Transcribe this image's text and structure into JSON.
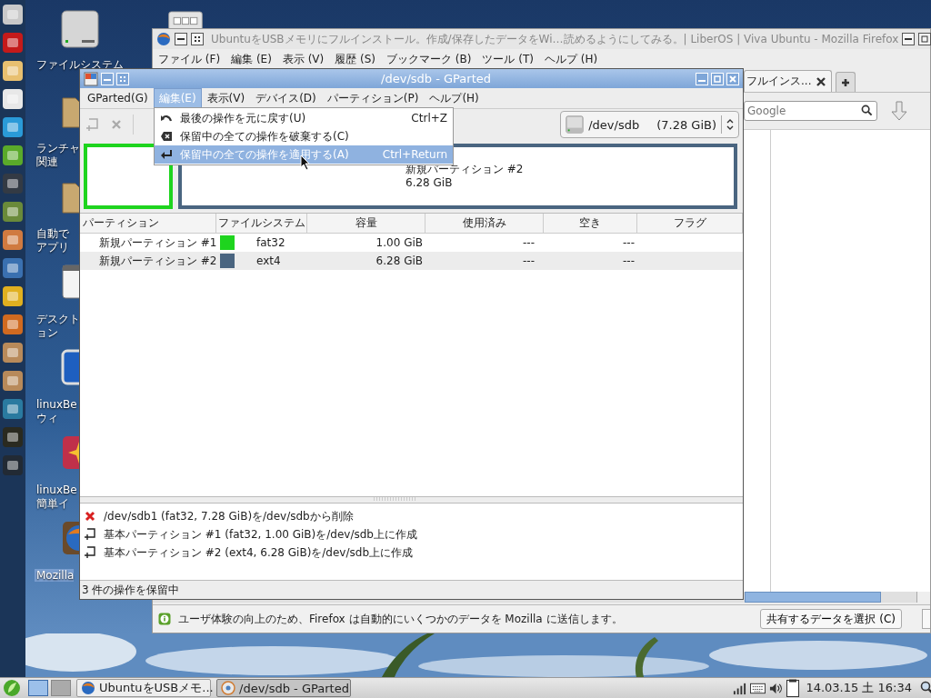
{
  "desktop_icons": [
    {
      "kind": "drive",
      "lines": [
        "ファイルシステム"
      ],
      "selected": false
    },
    {
      "kind": "folder",
      "lines": [
        "ランチャ",
        "関連"
      ],
      "selected": false
    },
    {
      "kind": "folder",
      "lines": [
        "自動で",
        "アプリ"
      ],
      "selected": false
    },
    {
      "kind": "window",
      "lines": [
        "デスクト",
        "ョン"
      ],
      "selected": false
    },
    {
      "kind": "blue-app",
      "lines": [
        "linuxBe",
        "ウィ"
      ],
      "selected": false
    },
    {
      "kind": "red-app",
      "lines": [
        "linuxBe",
        "簡単イ"
      ],
      "selected": false
    },
    {
      "kind": "globe",
      "lines": [
        "Mozilla"
      ],
      "selected": true
    }
  ],
  "firefox": {
    "title": "UbuntuをUSBメモリにフルインストール。作成/保存したデータをWi…読めるようにしてみる。| LiberOS | Viva Ubuntu - Mozilla Firefox",
    "menu": [
      "ファイル (F)",
      "編集 (E)",
      "表示 (V)",
      "履歴 (S)",
      "ブックマーク (B)",
      "ツール (T)",
      "ヘルプ (H)"
    ],
    "tab": {
      "label": "フルインス..."
    },
    "search": {
      "placeholder": "Google"
    },
    "notification": {
      "text": "ユーザ体験の向上のため、Firefox は自動的にいくつかのデータを Mozilla に送信します。",
      "button": "共有するデータを選択 (C)"
    }
  },
  "gparted": {
    "title": "/dev/sdb - GParted",
    "menu": [
      {
        "label": "GParted(G)",
        "selected": false
      },
      {
        "label": "編集(E)",
        "selected": true
      },
      {
        "label": "表示(V)",
        "selected": false
      },
      {
        "label": "デバイス(D)",
        "selected": false
      },
      {
        "label": "パーティション(P)",
        "selected": false
      },
      {
        "label": "ヘルプ(H)",
        "selected": false
      }
    ],
    "device": {
      "name": "/dev/sdb",
      "size": "(7.28 GiB)"
    },
    "disk_map": [
      {
        "color": "#1ed41e"
      },
      {
        "color": "#4a6580",
        "name": "新規パーティション #2",
        "size": "6.28 GiB"
      }
    ],
    "table": {
      "columns": [
        "パーティション",
        "ファイルシステム",
        "容量",
        "使用済み",
        "空き",
        "フラグ"
      ],
      "rows": [
        {
          "partition": "新規パーティション #1",
          "color": "#1ed41e",
          "filesystem": "fat32",
          "size": "1.00 GiB",
          "used": "---",
          "free": "---"
        },
        {
          "partition": "新規パーティション #2",
          "color": "#4a6580",
          "filesystem": "ext4",
          "size": "6.28 GiB",
          "used": "---",
          "free": "---"
        }
      ]
    },
    "operations": [
      {
        "kind": "delete",
        "text": "/dev/sdb1 (fat32, 7.28 GiB)を/dev/sdbから削除"
      },
      {
        "kind": "create",
        "text": "基本パーティション #1 (fat32, 1.00 GiB)を/dev/sdb上に作成"
      },
      {
        "kind": "create",
        "text": "基本パーティション #2 (ext4, 6.28 GiB)を/dev/sdb上に作成"
      }
    ],
    "status": "3 件の操作を保留中",
    "edit_menu": [
      {
        "kind": "undo",
        "label": "最後の操作を元に戻す(U)",
        "shortcut": "Ctrl+Z",
        "selected": false
      },
      {
        "kind": "clear",
        "label": "保留中の全ての操作を破棄する(C)",
        "selected": false
      },
      {
        "kind": "apply",
        "label": "保留中の全ての操作を適用する(A)",
        "shortcut": "Ctrl+Return",
        "selected": true
      }
    ]
  },
  "taskbar": {
    "workspaces": [
      {
        "selected": true
      },
      {
        "selected": false
      }
    ],
    "tasks": [
      {
        "kind": "firefox",
        "label": "UbuntuをUSBメモ...",
        "selected": false
      },
      {
        "kind": "gparted",
        "label": "/dev/sdb - GParted",
        "selected": true
      }
    ],
    "clock": "14.03.15 土 16:34"
  }
}
